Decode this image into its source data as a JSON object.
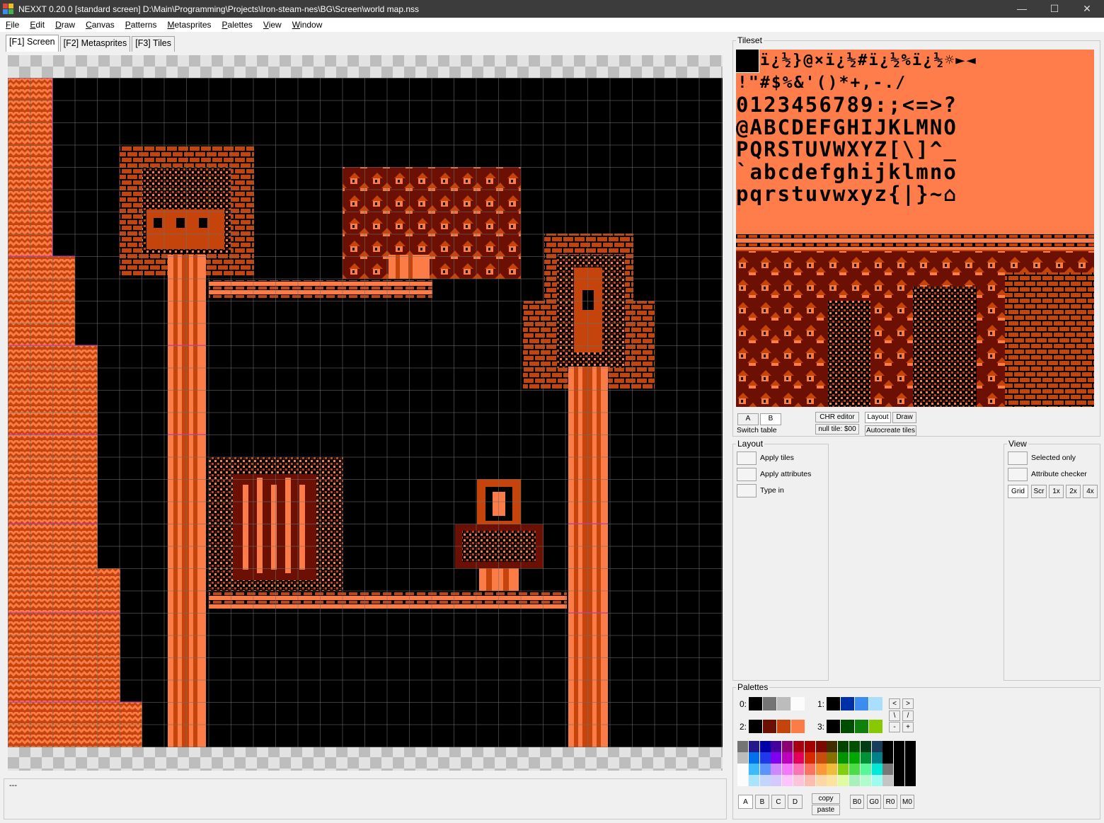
{
  "window": {
    "title": "NEXXT 0.20.0  [standard screen] D:\\Main\\Programming\\Projects\\Iron-steam-nes\\BG\\Screen\\world map.nss",
    "minimize": "—",
    "maximize": "☐",
    "close": "✕"
  },
  "menu": [
    "File",
    "Edit",
    "Draw",
    "Canvas",
    "Patterns",
    "Metasprites",
    "Palettes",
    "View",
    "Window"
  ],
  "tabs": [
    "[F1] Screen",
    "[F2] Metasprites",
    "[F3] Tiles"
  ],
  "status": {
    "text": "---"
  },
  "tileset": {
    "label": "Tileset",
    "text_rows": [
      "ï¿½}@×ï¿½#ï¿½%ï¿½☼►◄",
      "!\"#$%&'()*+,-./",
      "0123456789:;<=>?",
      "@ABCDEFGHIJKLMNO",
      "PQRSTUVWXYZ[\\]^_",
      "`abcdefghijklmno",
      "pqrstuvwxyz{|}~⌂"
    ],
    "table_a": "A",
    "table_b": "B",
    "switch_table": "Switch table",
    "chr_editor": "CHR editor",
    "null_tile": "null tile: $00",
    "layout_btn": "Layout",
    "draw_btn": "Draw",
    "autocreate": "Autocreate tiles"
  },
  "layout": {
    "label": "Layout",
    "apply_tiles": "Apply tiles",
    "apply_attributes": "Apply attributes",
    "type_in": "Type in"
  },
  "view": {
    "label": "View",
    "selected_only": "Selected only",
    "attribute_checker": "Attribute checker",
    "grid": "Grid",
    "scr": "Scr",
    "z1": "1x",
    "z2": "2x",
    "z4": "4x"
  },
  "palettes": {
    "label": "Palettes",
    "sets": [
      {
        "label": "0:",
        "colors": [
          "#000000",
          "#747474",
          "#bcbcbc",
          "#fcfcfc"
        ]
      },
      {
        "label": "1:",
        "colors": [
          "#000000",
          "#0030a8",
          "#3c8cf0",
          "#a8e0fc"
        ]
      },
      {
        "label": "2:",
        "colors": [
          "#000000",
          "#6c1004",
          "#c4440c",
          "#fc7c48"
        ]
      },
      {
        "label": "3:",
        "colors": [
          "#000000",
          "#004c00",
          "#10800c",
          "#88c800"
        ]
      }
    ],
    "nav": [
      "<",
      ">",
      "\\",
      "/",
      "-",
      "+"
    ],
    "bottom_buttons": [
      "A",
      "B",
      "C",
      "D"
    ],
    "copy": "copy",
    "paste": "paste",
    "emph": [
      "B0",
      "G0",
      "R0",
      "M0"
    ],
    "nes_rows": [
      [
        "#747474",
        "#24188c",
        "#0000a8",
        "#44009c",
        "#8c0074",
        "#a80010",
        "#a40000",
        "#7c0800",
        "#402c00",
        "#004400",
        "#005000",
        "#003c14",
        "#183c5c",
        "#000000",
        "#000000",
        "#000000"
      ],
      [
        "#bcbcbc",
        "#0070ec",
        "#2038ec",
        "#8000f0",
        "#bc00bc",
        "#e40058",
        "#d82800",
        "#c84c0c",
        "#887000",
        "#009400",
        "#00a800",
        "#009038",
        "#008088",
        "#000000",
        "#000000",
        "#000000"
      ],
      [
        "#fcfcfc",
        "#3cbcfc",
        "#5c94fc",
        "#cc88fc",
        "#f478fc",
        "#fc74b4",
        "#fc7460",
        "#fc9838",
        "#f0bc3c",
        "#80d010",
        "#4cdc48",
        "#58f898",
        "#00e8d8",
        "#787878",
        "#000000",
        "#000000"
      ],
      [
        "#fcfcfc",
        "#a8e4fc",
        "#c4d4fc",
        "#d4c8fc",
        "#fcc4fc",
        "#fcc4d8",
        "#fcbcb0",
        "#fcd8a8",
        "#fce4a0",
        "#e0fca0",
        "#a8f0bc",
        "#b0fccc",
        "#9cfcf0",
        "#c4c4c4",
        "#000000",
        "#000000"
      ]
    ]
  }
}
